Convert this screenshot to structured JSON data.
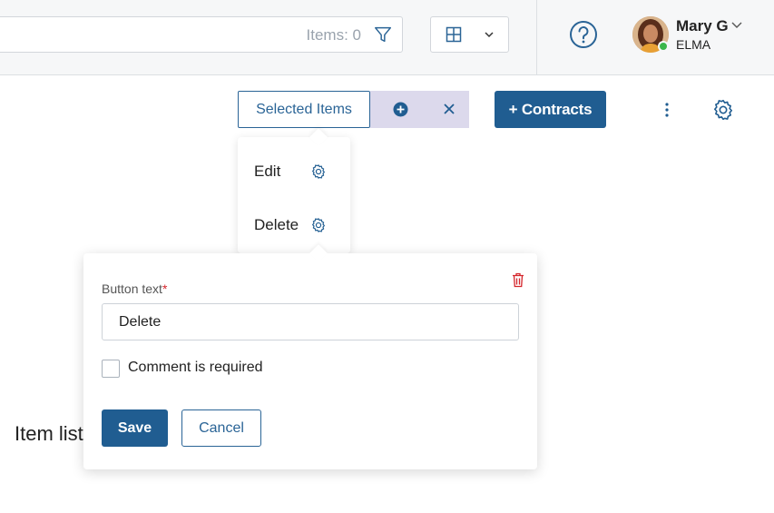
{
  "header": {
    "items_count": "Items: 0",
    "help_icon": "question-circle-icon",
    "user": {
      "name": "Mary G",
      "org": "ELMA",
      "status_color": "#3bb64a"
    }
  },
  "toolbar": {
    "selected_items_label": "Selected Items",
    "contracts_button_label": "+ Contracts",
    "accent_color": "#205d91"
  },
  "dropdown": {
    "items": [
      {
        "label": "Edit"
      },
      {
        "label": "Delete"
      }
    ]
  },
  "popover": {
    "field_label": "Button text",
    "required_mark": "*",
    "field_value": "Delete",
    "checkbox_label": "Comment is required",
    "checkbox_checked": false,
    "save_label": "Save",
    "cancel_label": "Cancel",
    "delete_color": "#d4252b"
  },
  "page": {
    "heading": "Item list"
  }
}
